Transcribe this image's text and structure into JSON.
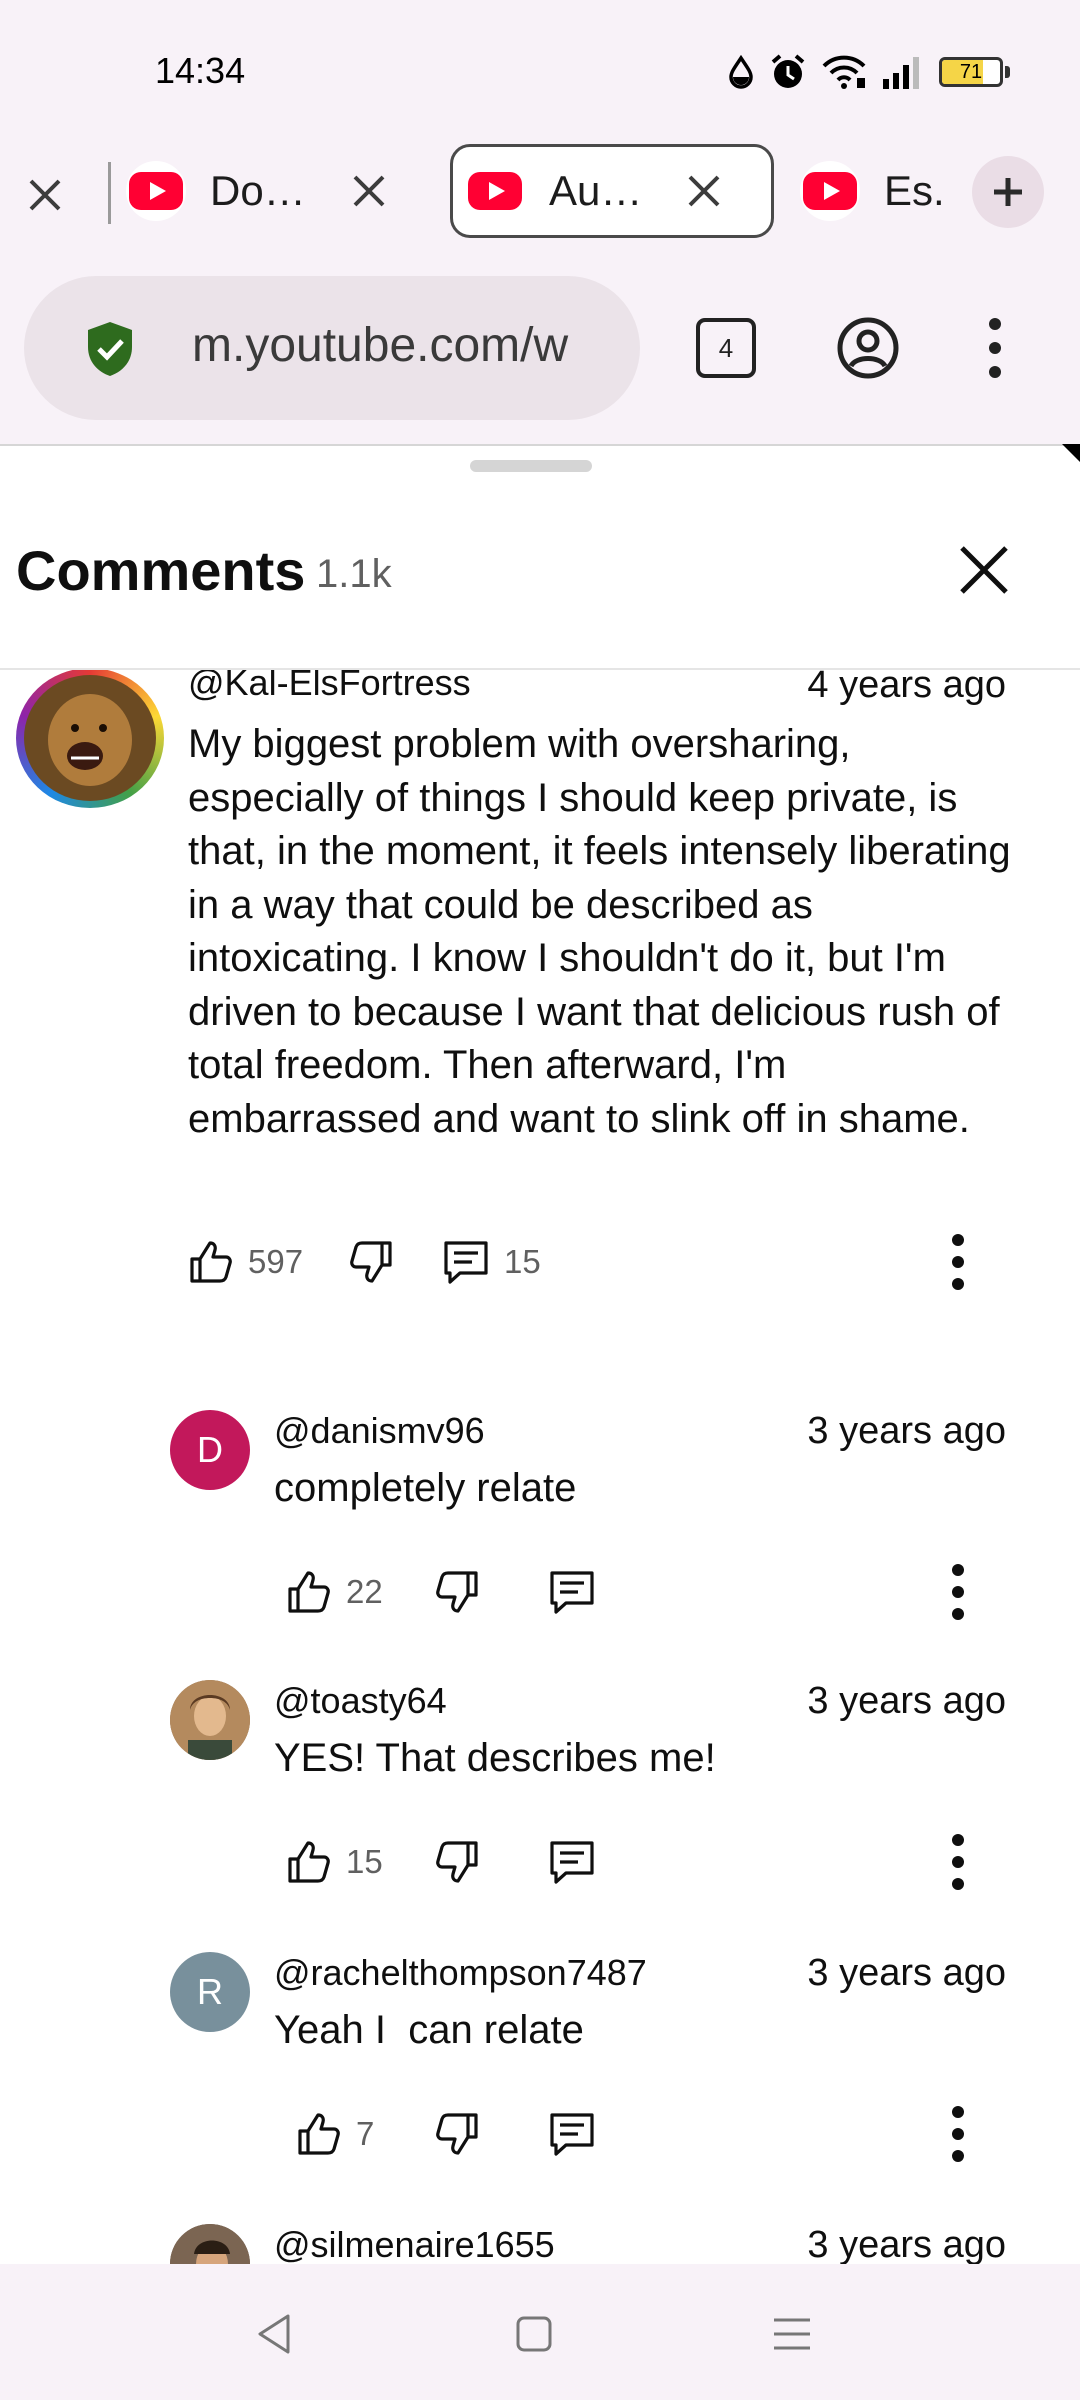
{
  "status_bar": {
    "time": "14:34",
    "battery_level": "71",
    "icons": [
      "drop-icon",
      "alarm-icon",
      "wifi-icon",
      "signal-icon",
      "battery-icon"
    ]
  },
  "tabs": [
    {
      "title": "Do…",
      "active": false
    },
    {
      "title": "Au…",
      "active": true
    },
    {
      "title": "Es.",
      "active": false
    }
  ],
  "url_bar": {
    "url": "m.youtube.com/w",
    "tab_count": "4"
  },
  "comments_panel": {
    "title": "Comments",
    "count": "1.1k"
  },
  "comments": [
    {
      "author": "@Kal-ElsFortress",
      "time": "4 years ago",
      "text": "My biggest problem with oversharing, especially of things I should keep private, is that, in the moment, it feels intensely liberating in a way that could be described as intoxicating. I know I shouldn't do it, but I'm driven to because I want that delicious rush of total freedom. Then afterward, I'm embarrassed and want to slink off in shame.",
      "likes": "597",
      "replies": "15"
    },
    {
      "author": "@danismv96",
      "avatar_letter": "D",
      "avatar_color": "#c2185b",
      "time": "3 years ago",
      "text": "completely relate",
      "likes": "22"
    },
    {
      "author": "@toasty64",
      "time": "3 years ago",
      "text": "YES! That describes me!",
      "likes": "15"
    },
    {
      "author": "@rachelthompson7487",
      "avatar_letter": "R",
      "avatar_color": "#78909c",
      "time": "3 years ago",
      "text": "Yeah I  can relate",
      "likes": "7"
    },
    {
      "author": "@silmenaire1655",
      "time": "3 years ago"
    }
  ],
  "nav_bar": {
    "buttons": [
      "back-icon",
      "home-icon",
      "recents-icon"
    ]
  }
}
